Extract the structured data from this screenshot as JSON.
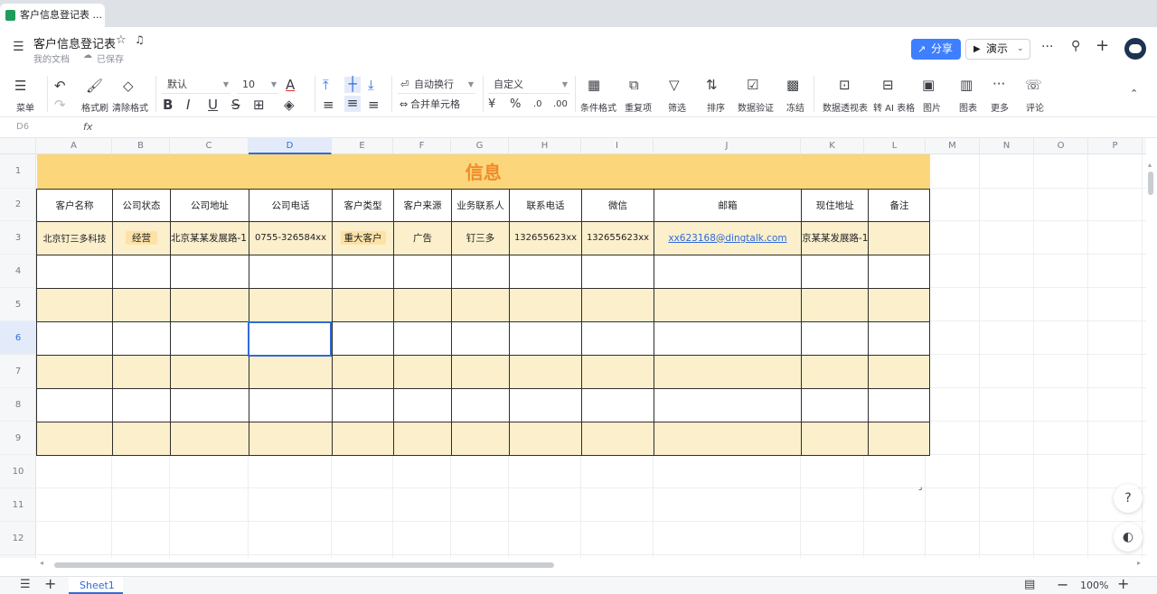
{
  "browser": {
    "tab_title": "客户信息登记表 ..."
  },
  "header": {
    "doc_title": "客户信息登记表",
    "breadcrumb": "我的文档",
    "save_status": "已保存",
    "share_label": "分享",
    "present_label": "演示",
    "accent_color": "#3d7fff"
  },
  "toolbar": {
    "menu": "菜单",
    "format_painter": "格式刷",
    "clear_format": "清除格式",
    "font_name": "默认",
    "font_size": "10",
    "wrap_text": "自动换行",
    "merge_cells": "合并单元格",
    "number_format": "自定义",
    "currency": "¥",
    "percent": "%",
    "cond_format": "条件格式",
    "duplicates": "重复项",
    "filter": "筛选",
    "sort": "排序",
    "data_validation": "数据验证",
    "freeze": "冻结",
    "pivot": "数据透视表",
    "to_ai_table": "转 AI 表格",
    "image": "图片",
    "chart": "图表",
    "more": "更多",
    "comment": "评论"
  },
  "formula_bar": {
    "cell_ref": "D6",
    "fx": "fx",
    "value": ""
  },
  "grid": {
    "columns": [
      "A",
      "B",
      "C",
      "D",
      "E",
      "F",
      "G",
      "H",
      "I",
      "J",
      "K",
      "L",
      "M",
      "N",
      "O",
      "P"
    ],
    "selected_column": "D",
    "rows": [
      "1",
      "2",
      "3",
      "4",
      "5",
      "6",
      "7",
      "8",
      "9",
      "10",
      "11",
      "12"
    ],
    "selected_row": "6"
  },
  "table": {
    "title": "信息",
    "headers": [
      "客户名称",
      "公司状态",
      "公司地址",
      "公司电话",
      "客户类型",
      "客户来源",
      "业务联系人",
      "联系电话",
      "微信",
      "邮箱",
      "现住地址",
      "备注"
    ],
    "row1": [
      "北京钉三多科技",
      "经营",
      "北京某某发展路-1",
      "0755-326584xx",
      "重大客户",
      "广告",
      "钉三多",
      "132655623xx",
      "132655623xx",
      "xx623168@dingtalk.com",
      "京某某发展路-1",
      ""
    ],
    "title_color": "#f08a2c",
    "header_band_color": "#fbd67a",
    "alt_row_color": "#fbefcc"
  },
  "footer": {
    "sheet_tab": "Sheet1",
    "zoom": "100%"
  }
}
